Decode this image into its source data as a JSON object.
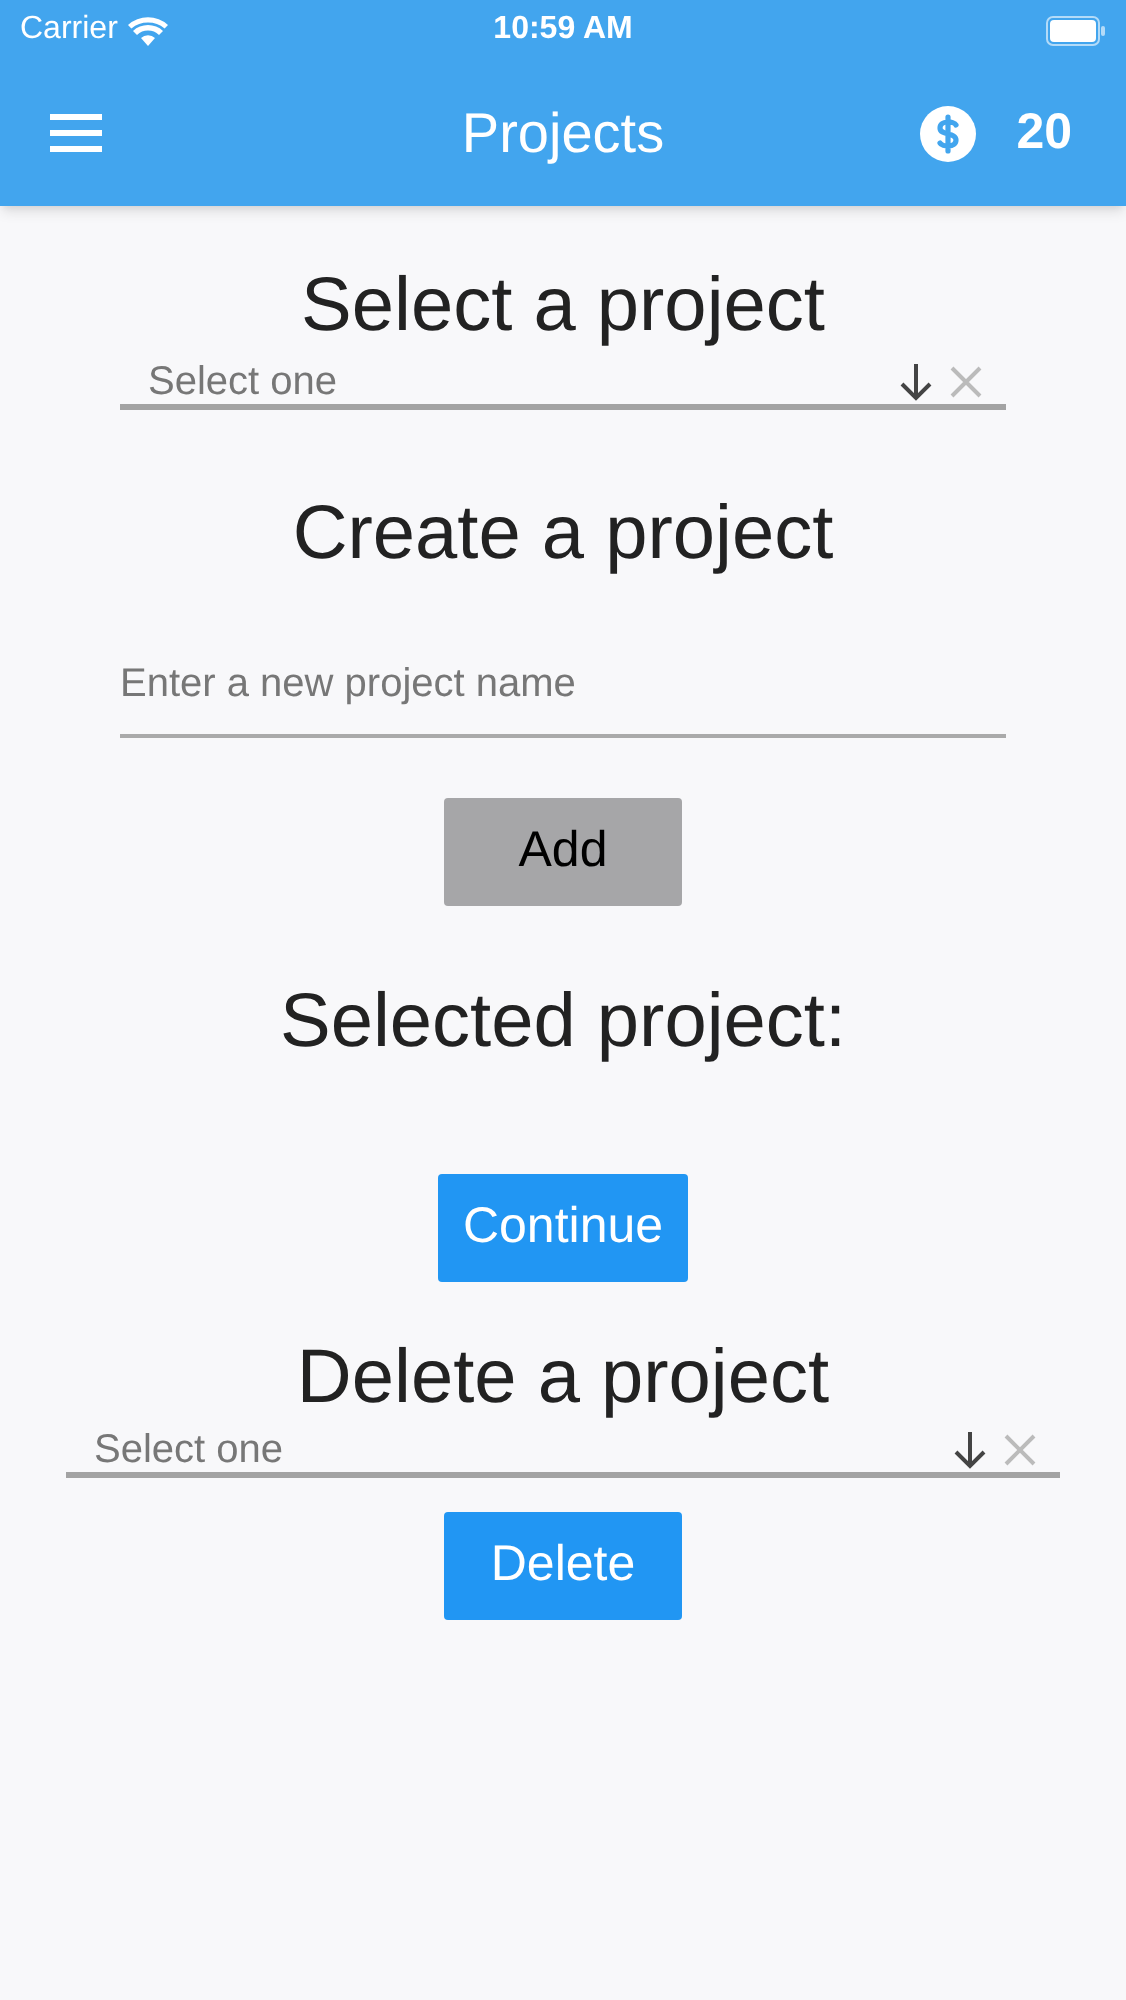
{
  "status_bar": {
    "carrier": "Carrier",
    "time": "10:59 AM"
  },
  "app_bar": {
    "title": "Projects",
    "coins": "20"
  },
  "items": [
    {
      "kind": "heading",
      "text": "Select a project"
    },
    {
      "kind": "dropdown",
      "placeholder": "Select one",
      "wide": false
    },
    {
      "kind": "heading",
      "text": "Create a project"
    },
    {
      "kind": "input",
      "placeholder": "Enter a new project name"
    },
    {
      "kind": "button",
      "label": "Add",
      "disabled": true
    },
    {
      "kind": "heading",
      "text": "Selected project:"
    },
    {
      "kind": "button",
      "label": "Continue",
      "disabled": false
    },
    {
      "kind": "heading",
      "text": "Delete a project"
    },
    {
      "kind": "dropdown",
      "placeholder": "Select one",
      "wide": true
    },
    {
      "kind": "button",
      "label": "Delete",
      "disabled": false
    }
  ]
}
